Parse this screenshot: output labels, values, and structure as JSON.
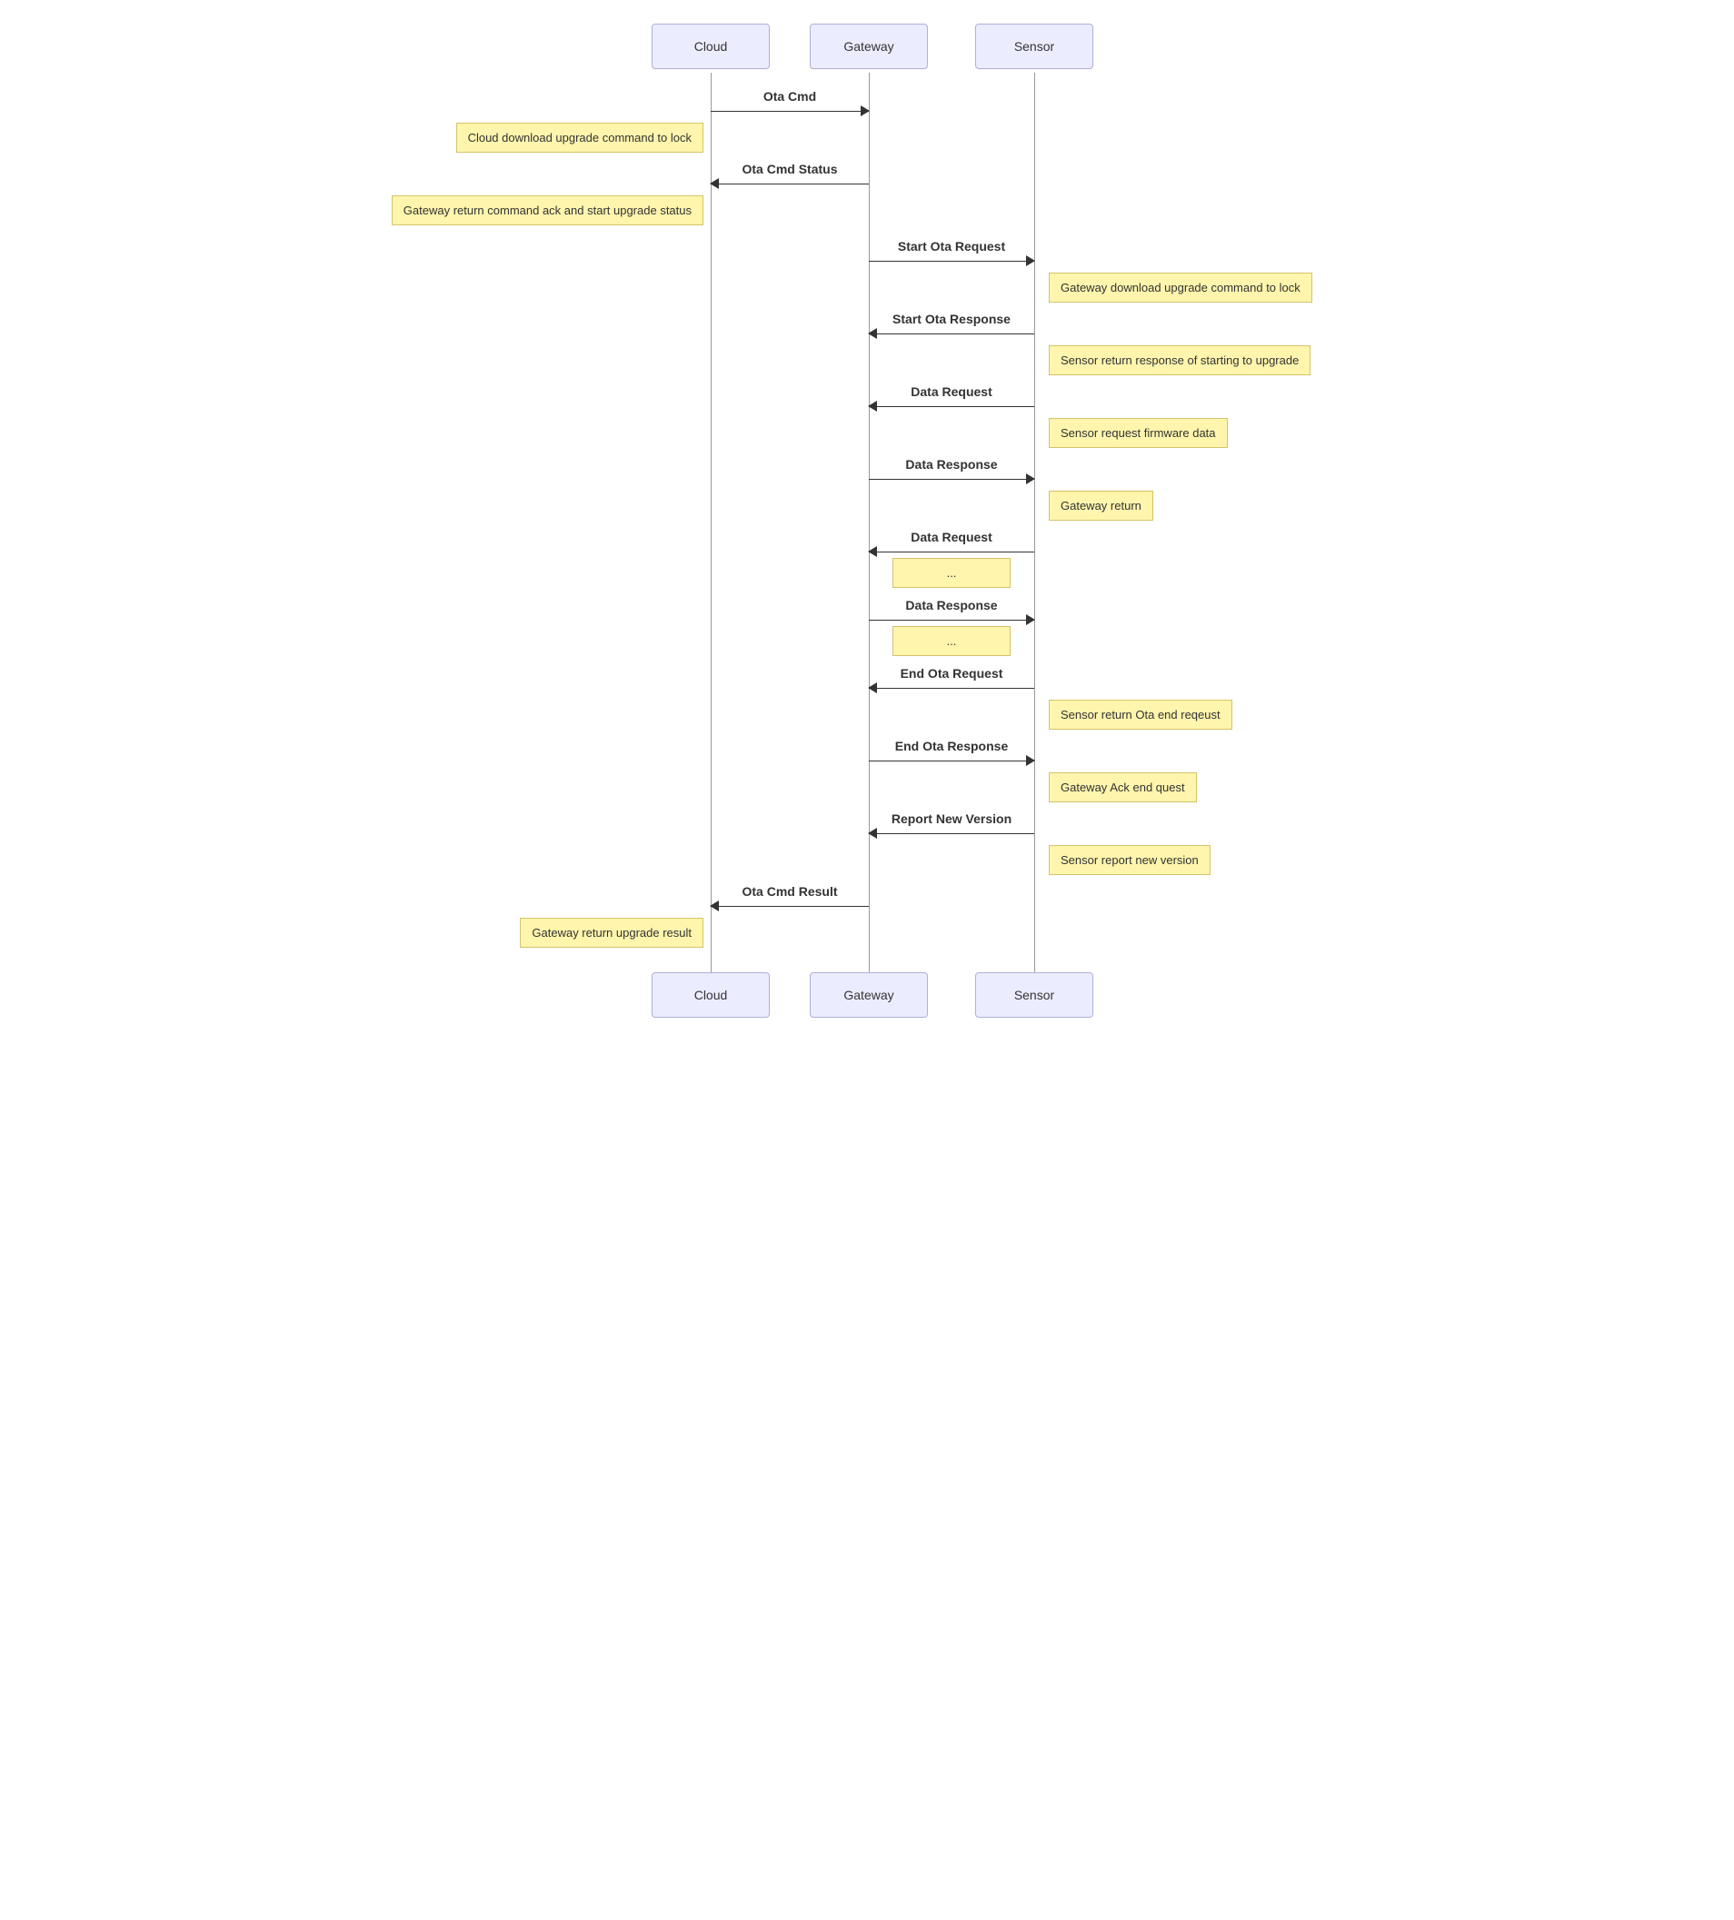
{
  "actors": {
    "cloud": "Cloud",
    "gateway": "Gateway",
    "sensor": "Sensor"
  },
  "messages": {
    "m1": "Ota Cmd",
    "m2": "Ota Cmd Status",
    "m3": "Start Ota Request",
    "m4": "Start Ota Response",
    "m5": "Data Request",
    "m6": "Data Response",
    "m7": "Data Request",
    "m8": "Data Response",
    "m9": "End Ota Request",
    "m10": "End Ota Response",
    "m11": "Report New Version",
    "m12": "Ota Cmd Result"
  },
  "notes": {
    "n1": "Cloud download upgrade command to lock",
    "n2": "Gateway return command ack and start upgrade status",
    "n3": "Gateway download upgrade command to lock",
    "n4": "Sensor return response of starting to upgrade",
    "n5": "Sensor request firmware data",
    "n6": "Gateway return",
    "n7": "...",
    "n8": "...",
    "n9": "Sensor return Ota end reqeust",
    "n10": "Gateway Ack end quest",
    "n11": "Sensor report new version",
    "n12": "Gateway return upgrade result"
  }
}
